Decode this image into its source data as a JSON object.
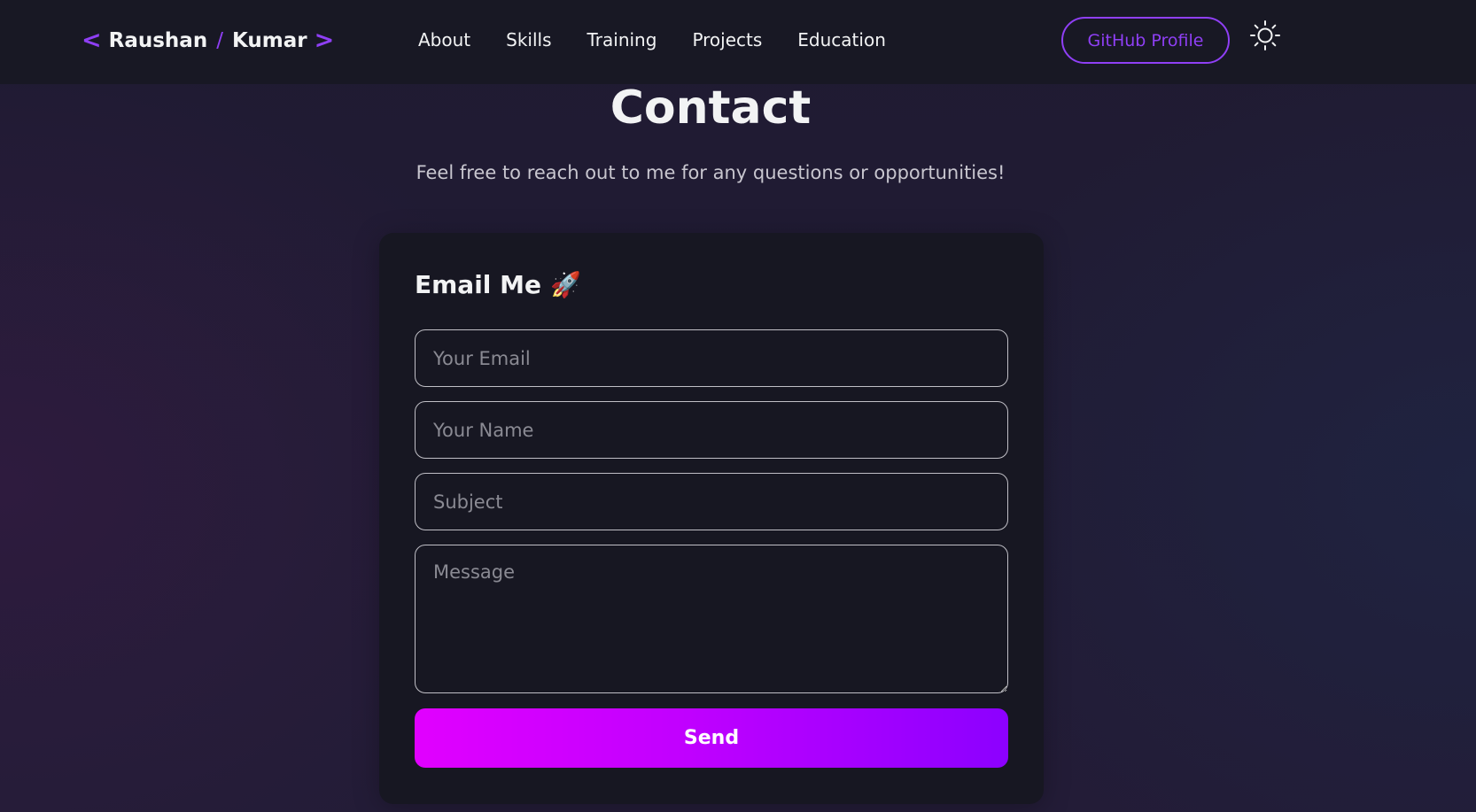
{
  "navbar": {
    "logo": {
      "first": "Raushan",
      "separator": "/",
      "last": "Kumar",
      "bracket_left": "<",
      "bracket_right": ">"
    },
    "links": [
      "About",
      "Skills",
      "Training",
      "Projects",
      "Education"
    ],
    "github_label": "GitHub Profile",
    "theme_icon": "sun-icon"
  },
  "contact": {
    "title": "Contact",
    "subtitle": "Feel free to reach out to me for any questions or opportunities!"
  },
  "form": {
    "title": "Email Me",
    "title_emoji": "🚀",
    "email_placeholder": "Your Email",
    "name_placeholder": "Your Name",
    "subject_placeholder": "Subject",
    "message_placeholder": "Message",
    "send_label": "Send"
  },
  "colors": {
    "accent": "#8f3ff5",
    "send_gradient_start": "#e100ff",
    "send_gradient_end": "#8c00ff",
    "nav_bg": "#181824",
    "card_bg": "#171722"
  }
}
